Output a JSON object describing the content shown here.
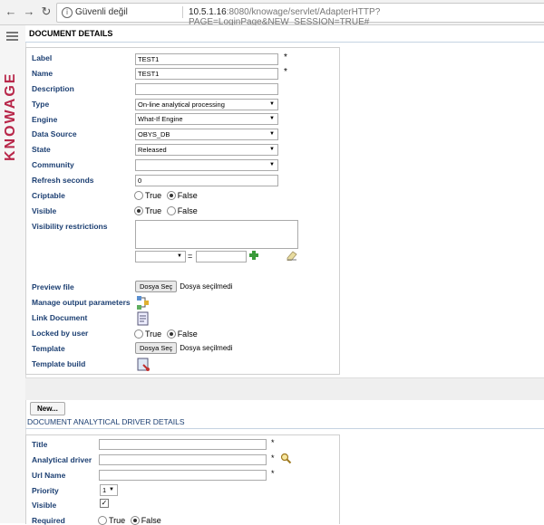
{
  "browser": {
    "security_label": "Güvenli değil",
    "url_host": "10.5.1.16",
    "url_path": ":8080/knowage/servlet/AdapterHTTP?PAGE=LoginPage&NEW_SESSION=TRUE#"
  },
  "app": {
    "logo_text": "KNOWAGE"
  },
  "document_details": {
    "title": "DOCUMENT DETAILS",
    "label": {
      "label": "Label",
      "value": "TEST1"
    },
    "name": {
      "label": "Name",
      "value": "TEST1"
    },
    "description": {
      "label": "Description",
      "value": ""
    },
    "type": {
      "label": "Type",
      "value": "On-line analytical processing"
    },
    "engine": {
      "label": "Engine",
      "value": "What-If Engine"
    },
    "data_source": {
      "label": "Data Source",
      "value": "OBYS_DB"
    },
    "state": {
      "label": "State",
      "value": "Released"
    },
    "community": {
      "label": "Community",
      "value": ""
    },
    "refresh_seconds": {
      "label": "Refresh seconds",
      "value": "0"
    },
    "criptable": {
      "label": "Criptable",
      "true_label": "True",
      "false_label": "False",
      "selected": "False"
    },
    "visible": {
      "label": "Visible",
      "true_label": "True",
      "false_label": "False",
      "selected": "True"
    },
    "visibility_restrictions": {
      "label": "Visibility restrictions",
      "equals": "="
    },
    "preview_file": {
      "label": "Preview file",
      "button": "Dosya Seç",
      "status": "Dosya seçilmedi"
    },
    "manage_output_parameters": {
      "label": "Manage output parameters"
    },
    "link_document": {
      "label": "Link Document"
    },
    "locked_by_user": {
      "label": "Locked by user",
      "true_label": "True",
      "false_label": "False",
      "selected": "False"
    },
    "template": {
      "label": "Template",
      "button": "Dosya Seç",
      "status": "Dosya seçilmedi"
    },
    "template_build": {
      "label": "Template build"
    },
    "required_mark": "*"
  },
  "new_button": "New...",
  "driver_details": {
    "title": "DOCUMENT ANALYTICAL DRIVER DETAILS",
    "title_field": {
      "label": "Title",
      "mark": "*"
    },
    "analytical_driver": {
      "label": "Analytical driver",
      "mark": "*"
    },
    "url_name": {
      "label": "Url Name",
      "mark": "*"
    },
    "priority": {
      "label": "Priority",
      "value": "1"
    },
    "visible": {
      "label": "Visible",
      "checked": true
    },
    "required": {
      "label": "Required",
      "true_label": "True",
      "false_label": "False",
      "selected": "False"
    }
  },
  "colors": {
    "label_blue": "#1c3f72",
    "logo_red": "#b8274a"
  }
}
